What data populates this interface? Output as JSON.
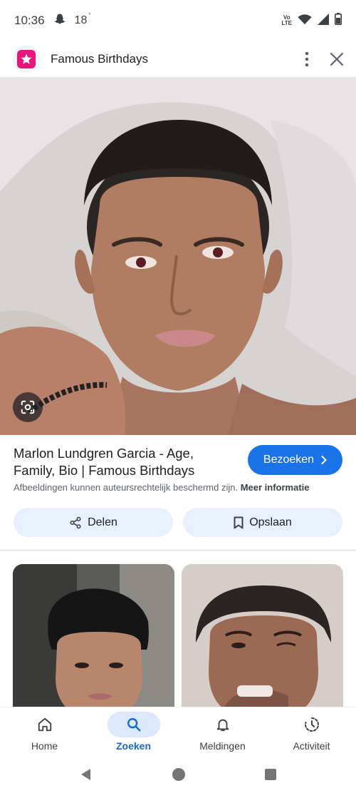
{
  "status_bar": {
    "time": "10:36",
    "temperature": "18",
    "degree_symbol": "°",
    "volte_top": "Vo",
    "volte_bottom": "LTE"
  },
  "header": {
    "site_name": "Famous Birthdays",
    "logo_color": "#e8157a"
  },
  "result": {
    "title": "Marlon Lundgren Garcia - Age, Family, Bio | Famous Birthdays",
    "visit_label": "Bezoeken",
    "copyright_text": "Afbeeldingen kunnen auteursrechtelijk beschermd zijn.",
    "more_info_label": "Meer informatie",
    "share_label": "Delen",
    "save_label": "Opslaan"
  },
  "bottom_nav": {
    "items": [
      {
        "label": "Home",
        "icon": "home-icon"
      },
      {
        "label": "Zoeken",
        "icon": "search-icon",
        "active": true
      },
      {
        "label": "Meldingen",
        "icon": "bell-icon"
      },
      {
        "label": "Activiteit",
        "icon": "activity-icon"
      }
    ]
  },
  "colors": {
    "accent": "#1a73e8",
    "button_bg": "#e8f0fe",
    "active_nav": "#1967d2"
  }
}
